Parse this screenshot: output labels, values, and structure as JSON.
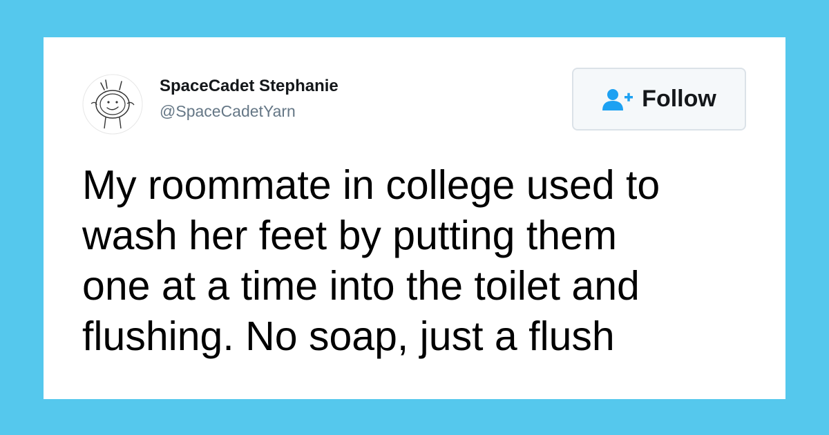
{
  "user": {
    "display_name": "SpaceCadet Stephanie",
    "handle": "@SpaceCadetYarn"
  },
  "follow_button": {
    "label": "Follow",
    "icon": "add-user-icon",
    "icon_color": "#1da1f2"
  },
  "tweet": {
    "lines": [
      "My roommate in college used to",
      "wash her feet by putting them",
      "one at a time into the toilet and",
      "flushing. No soap, just a flush"
    ]
  },
  "colors": {
    "background": "#55c8ed",
    "card": "#ffffff",
    "text": "#000000",
    "handle": "#657786"
  }
}
